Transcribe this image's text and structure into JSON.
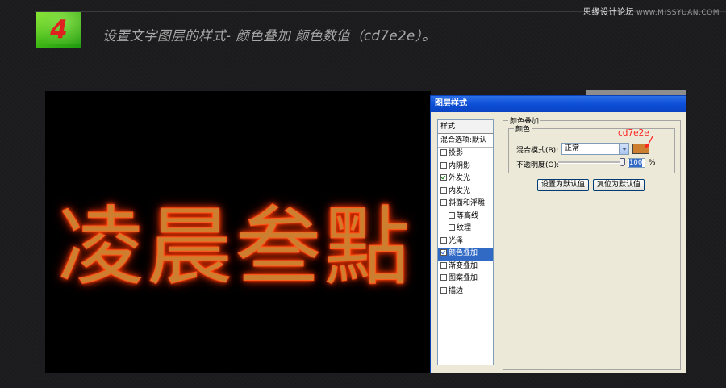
{
  "step": {
    "number": "4",
    "title": "设置文字图层的样式- 颜色叠加 颜色数值（cd7e2e）。"
  },
  "watermark": {
    "site_cn": "思缘设计论坛",
    "site_url": "www.MISSYUAN.COM"
  },
  "canvas": {
    "text": "凌晨叁點",
    "text_color": "#cd7e2e",
    "glow_color": "#ff3a00"
  },
  "dialog": {
    "title": "图层样式",
    "styles_header": "样式",
    "style_items": [
      {
        "label": "混合选项:默认",
        "checkbox": false,
        "checked": false,
        "selected": false,
        "sub": false
      },
      {
        "label": "投影",
        "checkbox": true,
        "checked": false,
        "selected": false,
        "sub": false
      },
      {
        "label": "内阴影",
        "checkbox": true,
        "checked": false,
        "selected": false,
        "sub": false
      },
      {
        "label": "外发光",
        "checkbox": true,
        "checked": true,
        "selected": false,
        "sub": false
      },
      {
        "label": "内发光",
        "checkbox": true,
        "checked": false,
        "selected": false,
        "sub": false
      },
      {
        "label": "斜面和浮雕",
        "checkbox": true,
        "checked": false,
        "selected": false,
        "sub": false
      },
      {
        "label": "等高线",
        "checkbox": true,
        "checked": false,
        "selected": false,
        "sub": true
      },
      {
        "label": "纹理",
        "checkbox": true,
        "checked": false,
        "selected": false,
        "sub": true
      },
      {
        "label": "光泽",
        "checkbox": true,
        "checked": false,
        "selected": false,
        "sub": false
      },
      {
        "label": "颜色叠加",
        "checkbox": true,
        "checked": true,
        "selected": true,
        "sub": false
      },
      {
        "label": "渐变叠加",
        "checkbox": true,
        "checked": false,
        "selected": false,
        "sub": false
      },
      {
        "label": "图案叠加",
        "checkbox": true,
        "checked": false,
        "selected": false,
        "sub": false
      },
      {
        "label": "描边",
        "checkbox": true,
        "checked": false,
        "selected": false,
        "sub": false
      }
    ],
    "panel_title": "颜色叠加",
    "group_title": "颜色",
    "blend_mode_label": "混合模式(B):",
    "blend_mode_value": "正常",
    "overlay_color": "#cd7e2e",
    "opacity_label": "不透明度(O):",
    "opacity_value": "100",
    "opacity_unit": "%",
    "btn_make_default": "设置为默认值",
    "btn_reset_default": "复位为默认值"
  },
  "annotation": {
    "text": "cd7e2e",
    "color": "#ff2020"
  }
}
